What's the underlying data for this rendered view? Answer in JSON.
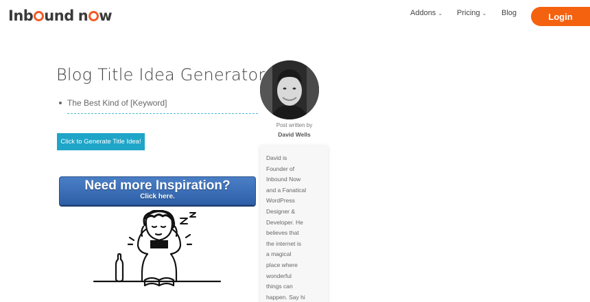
{
  "header": {
    "logo_part1": "Inb",
    "logo_part1b": "und",
    "logo_part2": "n",
    "logo_part2b": "w",
    "nav": [
      {
        "label": "Addons"
      },
      {
        "label": "Pricing"
      },
      {
        "label": "Blog"
      }
    ],
    "login_label": "Login"
  },
  "main": {
    "title": "Blog Title Idea Generator",
    "idea": "The Best Kind of [Keyword]",
    "generate_label": "Click to Generate Title Idea!",
    "inspire_main": "Need more Inspiration?",
    "inspire_sub": "Click here."
  },
  "author": {
    "post_written_by": "Post written by",
    "name": "David Wells",
    "bio_lines": [
      "David is",
      "Founder of",
      "Inbound Now",
      "and a Fanatical",
      "WordPress",
      "Designer &",
      "Developer. He",
      "believes that",
      "the internet is",
      "a magical",
      "place where",
      "wonderful",
      "things can",
      "happen. Say hi"
    ]
  },
  "colors": {
    "accent": "#f4620f",
    "button_teal": "#1ea5c7",
    "inspire_blue": "#3a6db8"
  },
  "icons": [
    "chevron-down-icon",
    "brand-logo"
  ]
}
